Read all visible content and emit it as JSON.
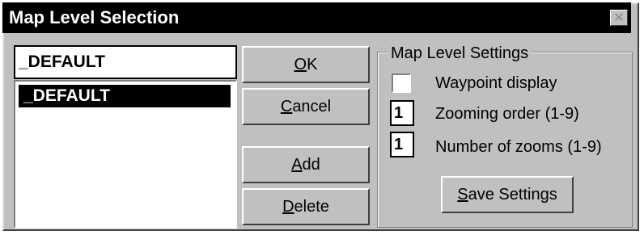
{
  "window": {
    "title": "Map Level Selection",
    "close_icon": "close-icon"
  },
  "name_field": {
    "value": "_DEFAULT"
  },
  "list": {
    "items": [
      {
        "label": "_DEFAULT",
        "selected": true
      }
    ]
  },
  "buttons": {
    "ok": {
      "mnemonic": "O",
      "rest": "K"
    },
    "cancel": {
      "mnemonic": "C",
      "rest": "ancel"
    },
    "add": {
      "mnemonic": "A",
      "rest": "dd"
    },
    "delete": {
      "mnemonic": "D",
      "rest": "elete"
    }
  },
  "settings": {
    "group_label": "Map Level Settings",
    "waypoint_display": {
      "label": "Waypoint display",
      "checked": false
    },
    "zooming_order": {
      "label": "Zooming order (1-9)",
      "value": "1"
    },
    "number_of_zooms": {
      "label": "Number of zooms (1-9)",
      "value": "1"
    },
    "save_button": {
      "mnemonic": "S",
      "rest": "ave Settings"
    }
  },
  "colors": {
    "face": "#c0c0c0",
    "titlebar": "#000000",
    "title_text": "#ffffff",
    "selection": "#000000"
  }
}
